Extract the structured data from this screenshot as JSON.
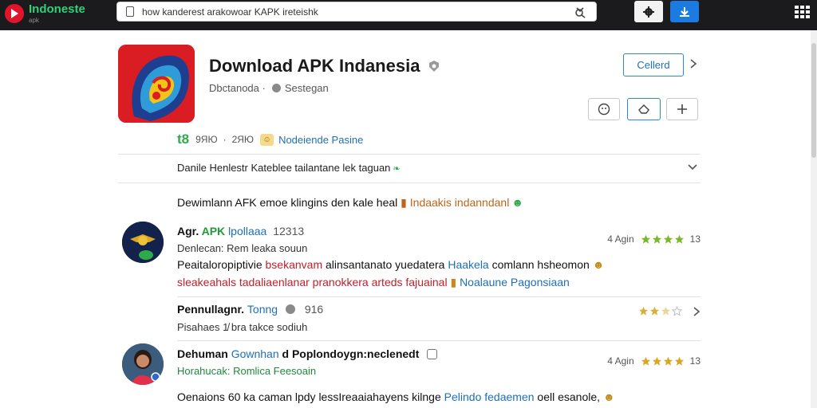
{
  "browser": {
    "brand_name": "Indoneste",
    "brand_sub": "apk",
    "address": "how kanderest arakowoar KAPK ireteishk"
  },
  "app": {
    "title": "Download APK Indanesia",
    "developer": "Dbctanoda ·",
    "category": "Sestegan",
    "install_label": "Cellerd",
    "stats": {
      "mark": "t8",
      "rating": "9ЯЮ",
      "size": "2ЯЮ",
      "badge_text": "Nodeiende Pasine"
    },
    "description": "Danile Henlestr Kateblee tailantane lek taguan",
    "summary_main": "Dewimlann AFK emoe klingins den kale heal",
    "summary_highlight": "Indaakis indanndanl"
  },
  "reviews": [
    {
      "author": "Agr.",
      "author_green": "APK",
      "author_blue": "lpollaaa",
      "number": "12313",
      "subtitle": "Denlecan: Rem leaka souun",
      "body_1": "Peaitaloropiptivie",
      "body_1_red": "bsekanvam",
      "body_1_b": "alinsantanato yuedatera",
      "body_1_blue": "Haakela",
      "body_1_c": "comlann hsheomon",
      "body_2_red": "sleakeahals tadaliaenlanar pranokkera arteds fajuainal",
      "body_2_blue": "Noalaune Pagonsiaan",
      "date": "4 Agin",
      "rating": 4,
      "score": "13"
    },
    {
      "author": "Pennullagnr.",
      "author_blue": "Tonng",
      "number": "916",
      "subtitle": "Pisahaes 1̸ bra takce sodiuh",
      "rating": 2.5
    },
    {
      "author": "Dehuman",
      "author_blue": "Gownhan",
      "author_rest": "d Poplondoygn:neclenedt",
      "subtitle": "Horahucak: Romlica Feesoain",
      "body_1": "Oenaions 60 ka caman lpdy lessIreaaiahayens kilnge",
      "body_1_blue": "Pelindo fedaemen",
      "body_1_c": "oell esanole,",
      "date": "4 Agin",
      "rating": 4,
      "score": "13"
    }
  ],
  "colors": {
    "topbar": "#1b1b1d",
    "brand_green": "#2fd17a",
    "accent_blue": "#1b7be0",
    "link_blue": "#1f6fb5",
    "star_yellow": "#7cb82f",
    "app_icon_red": "#d91d22"
  },
  "icons": [
    "play-logo-icon",
    "search-icon",
    "gear-icon",
    "download-icon",
    "grid-menu-icon",
    "verified-icon",
    "smiley-icon",
    "like-icon",
    "plus-icon",
    "chevron-right-icon",
    "chevron-down-icon",
    "star-icon"
  ]
}
